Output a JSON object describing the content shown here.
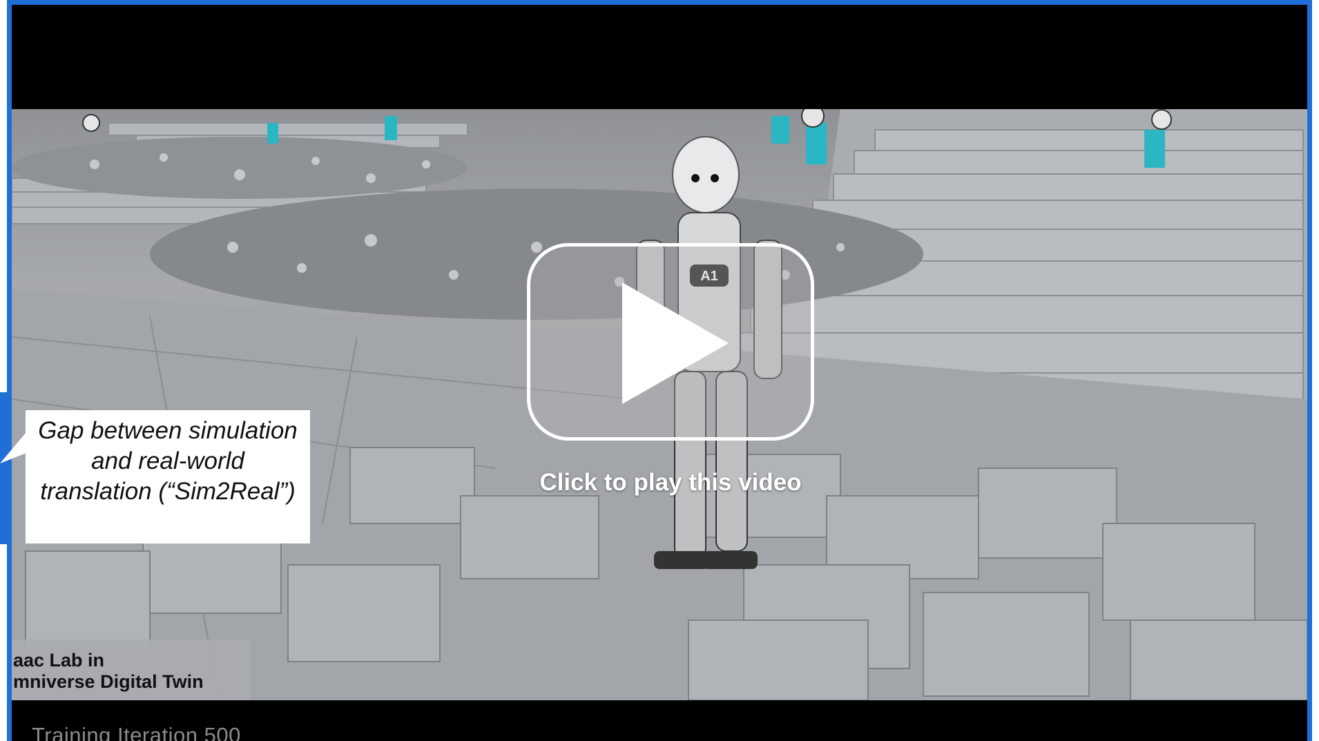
{
  "video": {
    "play_label": "Click to play this video",
    "overlay_label_line1": "aac Lab in",
    "overlay_label_line2": "mniverse Digital Twin",
    "training_caption": "Training Iteration 500",
    "robot_badge": "A1"
  },
  "callout": {
    "text": "Gap between simulation and real-world translation (“Sim2Real”)"
  },
  "colors": {
    "frame_border": "#1f6fd6",
    "robot_accent": "#2bb6c4",
    "callout_bg": "#ffffff"
  },
  "icons": {
    "play": "play-triangle-icon"
  }
}
